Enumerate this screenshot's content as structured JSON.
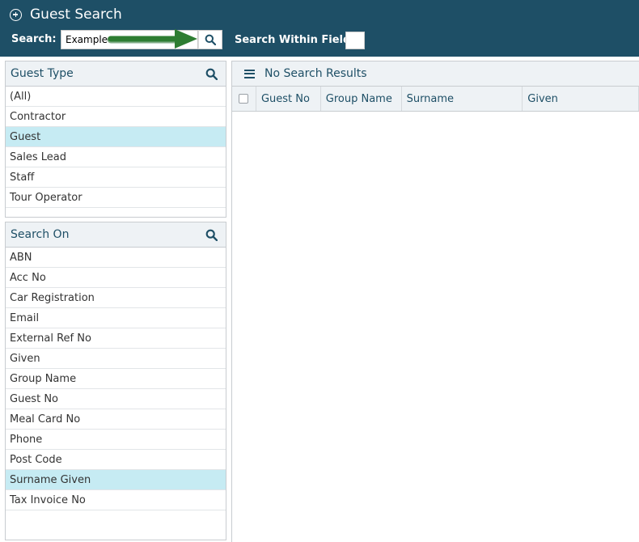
{
  "app": {
    "title": "Guest Search"
  },
  "search": {
    "label": "Search:",
    "value": "Example",
    "within_label": "Search Within Field:"
  },
  "guest_type": {
    "title": "Guest Type",
    "items": [
      "(All)",
      "Contractor",
      "Guest",
      "Sales Lead",
      "Staff",
      "Tour Operator"
    ],
    "selected": "Guest"
  },
  "search_on": {
    "title": "Search On",
    "items": [
      "ABN",
      "Acc No",
      "Car Registration",
      "Email",
      "External Ref No",
      "Given",
      "Group Name",
      "Guest No",
      "Meal Card No",
      "Phone",
      "Post Code",
      "Surname Given",
      "Tax Invoice No"
    ],
    "selected": "Surname Given"
  },
  "results": {
    "title": "No Search Results",
    "columns": [
      "Guest No",
      "Group Name",
      "Surname",
      "Given"
    ]
  },
  "colors": {
    "header_bg": "#1e4f66",
    "accent": "#1e4f66",
    "selected_bg": "#c6ebf3",
    "arrow": "#2e7d32"
  }
}
